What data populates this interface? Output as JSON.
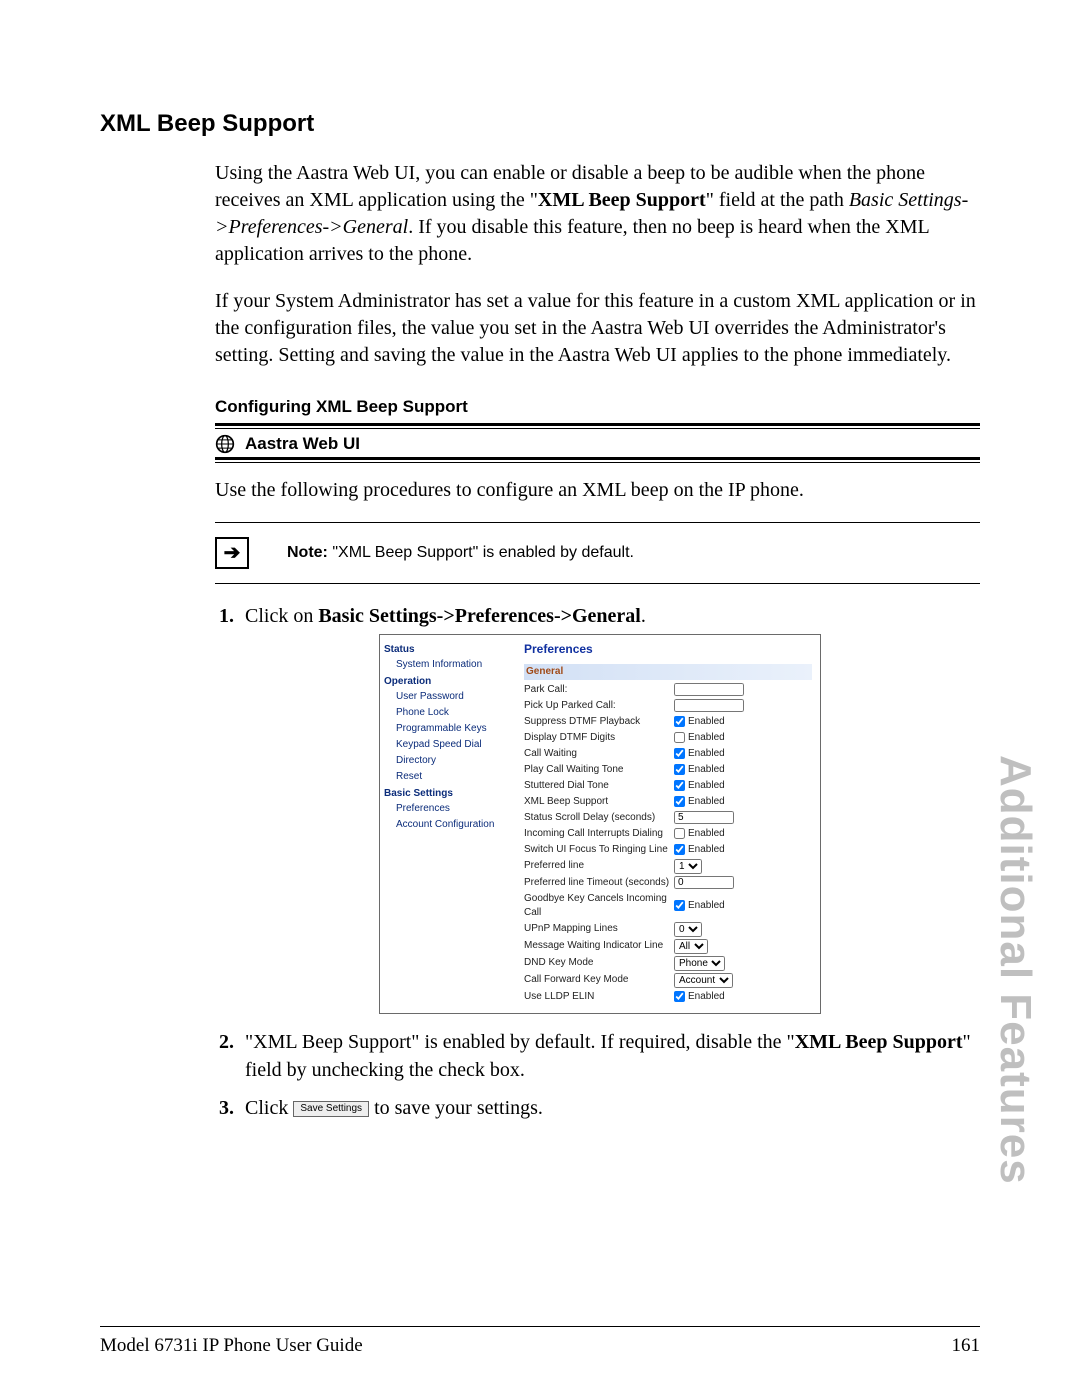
{
  "sideTab": "Additional Features",
  "heading": "XML Beep Support",
  "para1_a": "Using the Aastra Web UI, you can enable or disable a beep to be audible when the phone receives an XML application using the \"",
  "para1_bold": "XML Beep Support",
  "para1_b": "\" field at the path ",
  "para1_italic": "Basic Settings->Preferences->General",
  "para1_c": ". If you disable this feature, then no beep is heard when the XML application arrives to the phone.",
  "para2": "If your System Administrator has set a value for this feature in a custom XML application or in the configuration files, the value you set in the Aastra Web UI overrides the Administrator's setting. Setting and saving the value in the Aastra Web UI applies to the phone immediately.",
  "subhead": "Configuring XML Beep Support",
  "procTitle": "Aastra Web UI",
  "procIntro": "Use the following procedures to configure an XML beep on the IP phone.",
  "noteLabel": "Note:",
  "noteText": " \"XML Beep Support\" is enabled by default.",
  "step1_a": "Click on ",
  "step1_bold": "Basic Settings->Preferences->General",
  "step1_b": ".",
  "step2_a": "\"XML Beep Support\" is enabled by default. If required, disable the \"",
  "step2_bold": "XML Beep Support",
  "step2_b": "\" field by unchecking the check box.",
  "step3_a": "Click ",
  "step3_btn": "Save Settings",
  "step3_b": " to save your settings.",
  "footerLeft": "Model 6731i IP Phone User Guide",
  "footerRight": "161",
  "prefs": {
    "nav": {
      "h1": "Status",
      "h1_items": [
        "System Information"
      ],
      "h2": "Operation",
      "h2_items": [
        "User Password",
        "Phone Lock",
        "Programmable Keys",
        "Keypad Speed Dial",
        "Directory",
        "Reset"
      ],
      "h3": "Basic Settings",
      "h3_items": [
        "Preferences",
        "Account Configuration"
      ]
    },
    "panelTitle": "Preferences",
    "sectionLabel": "General",
    "rows": [
      {
        "label": "Park Call:",
        "type": "text",
        "value": ""
      },
      {
        "label": "Pick Up Parked Call:",
        "type": "text",
        "value": ""
      },
      {
        "label": "Suppress DTMF Playback",
        "type": "checkbox",
        "checked": true,
        "text": "Enabled"
      },
      {
        "label": "Display DTMF Digits",
        "type": "checkbox",
        "checked": false,
        "text": "Enabled"
      },
      {
        "label": "Call Waiting",
        "type": "checkbox",
        "checked": true,
        "text": "Enabled"
      },
      {
        "label": "Play Call Waiting Tone",
        "type": "checkbox",
        "checked": true,
        "text": "Enabled"
      },
      {
        "label": "Stuttered Dial Tone",
        "type": "checkbox",
        "checked": true,
        "text": "Enabled"
      },
      {
        "label": "XML Beep Support",
        "type": "checkbox",
        "checked": true,
        "text": "Enabled"
      },
      {
        "label": "Status Scroll Delay (seconds)",
        "type": "text",
        "value": "5",
        "width": "60"
      },
      {
        "label": "Incoming Call Interrupts Dialing",
        "type": "checkbox",
        "checked": false,
        "text": "Enabled"
      },
      {
        "label": "Switch UI Focus To Ringing Line",
        "type": "checkbox",
        "checked": true,
        "text": "Enabled"
      },
      {
        "label": "Preferred line",
        "type": "select",
        "value": "1"
      },
      {
        "label": "Preferred line Timeout (seconds)",
        "type": "text",
        "value": "0",
        "width": "60"
      },
      {
        "label": "Goodbye Key Cancels Incoming Call",
        "type": "checkbox",
        "checked": true,
        "text": "Enabled"
      },
      {
        "label": "UPnP Mapping Lines",
        "type": "select",
        "value": "0"
      },
      {
        "label": "Message Waiting Indicator Line",
        "type": "select",
        "value": "All"
      },
      {
        "label": "DND Key Mode",
        "type": "select",
        "value": "Phone"
      },
      {
        "label": "Call Forward Key Mode",
        "type": "select",
        "value": "Account"
      },
      {
        "label": "Use LLDP ELIN",
        "type": "checkbox",
        "checked": true,
        "text": "Enabled"
      }
    ]
  }
}
